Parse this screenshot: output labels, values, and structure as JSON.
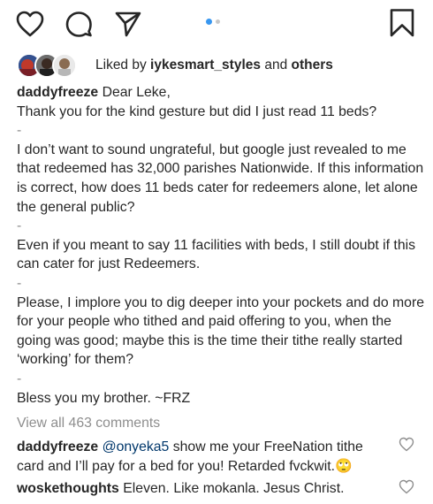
{
  "actions": {
    "like_icon": "heart-outline-icon",
    "comment_icon": "comment-bubble-icon",
    "share_icon": "paper-plane-icon",
    "save_icon": "bookmark-icon",
    "carousel_active_color": "#3897f0",
    "carousel_inactive_color": "#c7c7c7"
  },
  "likes": {
    "prefix": "Liked by ",
    "user": "iykesmart_styles",
    "connector": " and ",
    "others": "others"
  },
  "caption": {
    "username": "daddyfreeze",
    "lines": [
      "Dear Leke,",
      "Thank you for the kind gesture but did I just read 11 beds?",
      "-",
      "I don’t want to sound ungrateful, but google just revealed to me that redeemed has 32,000 parishes Nationwide. If this information is correct, how does 11 beds cater for redeemers alone, let alone the general public?",
      "-",
      "Even if you meant to say 11 facilities with beds, I still doubt if this can cater for just Redeemers.",
      "-",
      "Please, I implore you to dig deeper into your pockets and do more for your people who tithed and paid offering to you, when the going was good; maybe this is the time their tithe really started ‘working’ for them?",
      "-",
      "Bless you my brother. ~FRZ"
    ]
  },
  "comments": {
    "view_all": "View all 463 comments",
    "items": [
      {
        "username": "daddyfreeze",
        "mention": "@onyeka5",
        "text": " show me your FreeNation tithe card and I’ll pay for a bed for you! Retarded fvckwit.",
        "emoji": "🙄"
      },
      {
        "username": "woskethoughts",
        "text": " Eleven. Like mokanla. Jesus Christ."
      }
    ]
  }
}
